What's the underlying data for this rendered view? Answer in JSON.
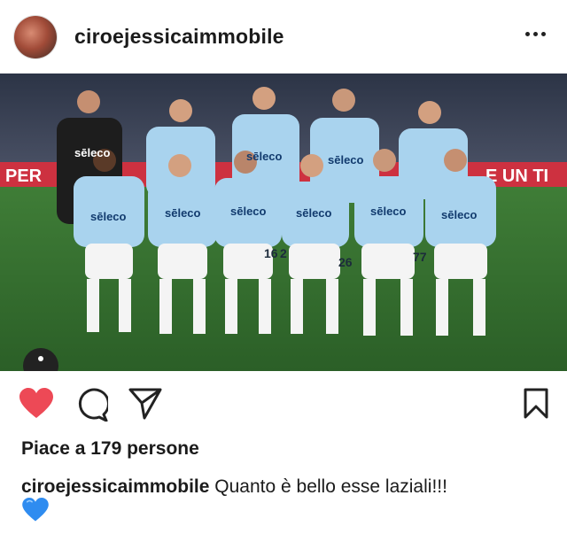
{
  "post": {
    "username": "ciroejessicaimmobile",
    "more_icon": "ellipsis-icon",
    "likes_text": "Piace a 179 persone",
    "caption_username": "ciroejessicaimmobile",
    "caption_text": "Quanto è bello esse laziali!!!",
    "caption_emoji": "blue-heart-emoji"
  },
  "photo": {
    "banner_left": "PER",
    "banner_right": "E UN TI",
    "jersey_sponsor": "sēleco",
    "numbers": [
      "16",
      "2",
      "26",
      "77"
    ]
  },
  "colors": {
    "like_red": "#ed4956",
    "blue_heart": "#2f8cf0",
    "jersey": "#a9d3ee",
    "pitch": "#2f6e2c"
  }
}
